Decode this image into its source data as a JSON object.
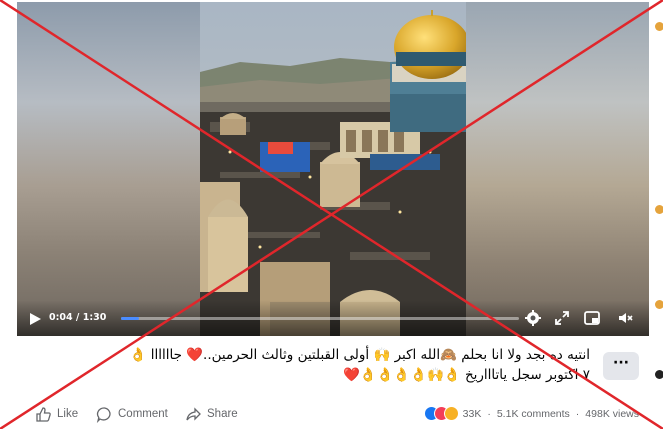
{
  "video": {
    "time_display": "0:04 / 1:30",
    "progress": 0.045,
    "controls": [
      "play-icon",
      "settings-icon",
      "fullscreen-icon",
      "picture-in-picture-icon",
      "volume-icon"
    ]
  },
  "post": {
    "caption_line1": "انتيه ده بجد ولا انا بحلم 🙈الله اكبر 🙌 أولى القبلتين وثالث الحرمين..❤️ جاااااا 👌",
    "caption_line2": "٧ اكتوبر سجل ياتاااريخ 👌🙌👌👌👌👌❤️",
    "more_label": "···"
  },
  "actions": {
    "like_label": "Like",
    "comment_label": "Comment",
    "share_label": "Share"
  },
  "stats": {
    "reactions_count": "33K",
    "comments": "5.1K comments",
    "views": "498K views"
  },
  "colors": {
    "accent": "#1877f2",
    "cross": "#e0262b",
    "dome_gold": "#d9a62a"
  }
}
